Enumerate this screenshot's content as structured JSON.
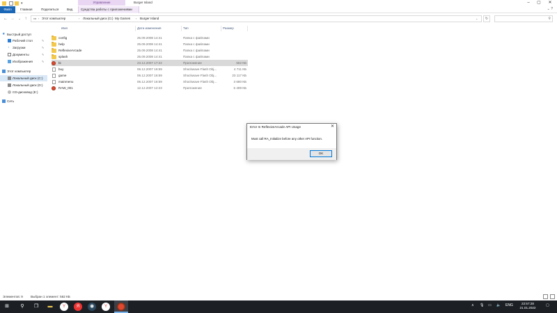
{
  "window": {
    "title": "Burger Island",
    "manage_tab": "Управление"
  },
  "ribbon": {
    "tabs": [
      {
        "label": "Файл"
      },
      {
        "label": "Главная"
      },
      {
        "label": "Поделиться"
      },
      {
        "label": "Вид"
      },
      {
        "label": "Средства работы с приложениями"
      }
    ]
  },
  "address": {
    "crumbs": [
      "Этот компьютер",
      "Локальный диск (C:)",
      "My Games",
      "Burger Island"
    ]
  },
  "navpane": {
    "items": [
      {
        "label": "Быстрый доступ",
        "icon": "star-icon"
      },
      {
        "label": "Рабочий стол",
        "icon": "desktop-icon",
        "pinned": true
      },
      {
        "label": "Загрузки",
        "icon": "download-icon",
        "pinned": true
      },
      {
        "label": "Документы",
        "icon": "documents-icon",
        "pinned": true
      },
      {
        "label": "Изображения",
        "icon": "pictures-icon",
        "pinned": true
      },
      {
        "label": "Этот компьютер",
        "icon": "computer-icon"
      },
      {
        "label": "Локальный диск (C:)",
        "icon": "drive-icon",
        "selected": true
      },
      {
        "label": "Локальный диск (D:)",
        "icon": "drive-icon"
      },
      {
        "label": "CD-дисковод (E:)",
        "icon": "cd-drive-icon"
      },
      {
        "label": "Сеть",
        "icon": "network-icon"
      }
    ]
  },
  "filelist": {
    "columns": {
      "name": "Имя",
      "date": "Дата изменения",
      "type": "Тип",
      "size": "Размер"
    },
    "rows": [
      {
        "name": "config",
        "date": "25.09.2008 14:41",
        "type": "Папка с файлами",
        "size": "",
        "icon": "folder-icon"
      },
      {
        "name": "help",
        "date": "25.09.2008 14:41",
        "type": "Папка с файлами",
        "size": "",
        "icon": "folder-icon"
      },
      {
        "name": "ReflexiveArcade",
        "date": "25.09.2008 14:41",
        "type": "Папка с файлами",
        "size": "",
        "icon": "folder-icon"
      },
      {
        "name": "splash",
        "date": "25.09.2008 14:41",
        "type": "Папка с файлами",
        "size": "",
        "icon": "folder-icon"
      },
      {
        "name": "bi",
        "date": "23.12.2007 17:22",
        "type": "Приложение",
        "size": "562 КБ",
        "icon": "app-icon",
        "selected": true
      },
      {
        "name": "buy",
        "date": "06.12.2007 16:59",
        "type": "Shockwave Flash Obj...",
        "size": "4 711 КБ",
        "icon": "document-icon"
      },
      {
        "name": "game",
        "date": "06.12.2007 16:59",
        "type": "Shockwave Flash Obj...",
        "size": "23 117 КБ",
        "icon": "document-icon"
      },
      {
        "name": "mainmenu",
        "date": "06.12.2007 16:59",
        "type": "Shockwave Flash Obj...",
        "size": "3 680 КБ",
        "icon": "document-icon"
      },
      {
        "name": "RAW_001",
        "date": "12.12.2007 12:23",
        "type": "Приложение",
        "size": "6 499 КБ",
        "icon": "app-icon"
      }
    ]
  },
  "dialog": {
    "title": "Error In ReflexiveArcade API Usage",
    "message": "Must call RA_Initialize before any other API function.",
    "ok_label": "OK"
  },
  "statusbar": {
    "items_count": "Элементов: 9",
    "selected": "Выбран 1 элемент: 562 КБ"
  },
  "taskbar": {
    "language": "ENG",
    "time": "22:57:28",
    "date": "21.01.2022"
  },
  "colors": {
    "accent": "#1a67b8",
    "manage": "#e8d6f3",
    "taskbar": "#1c2025",
    "selection": "#d9e8f7"
  }
}
